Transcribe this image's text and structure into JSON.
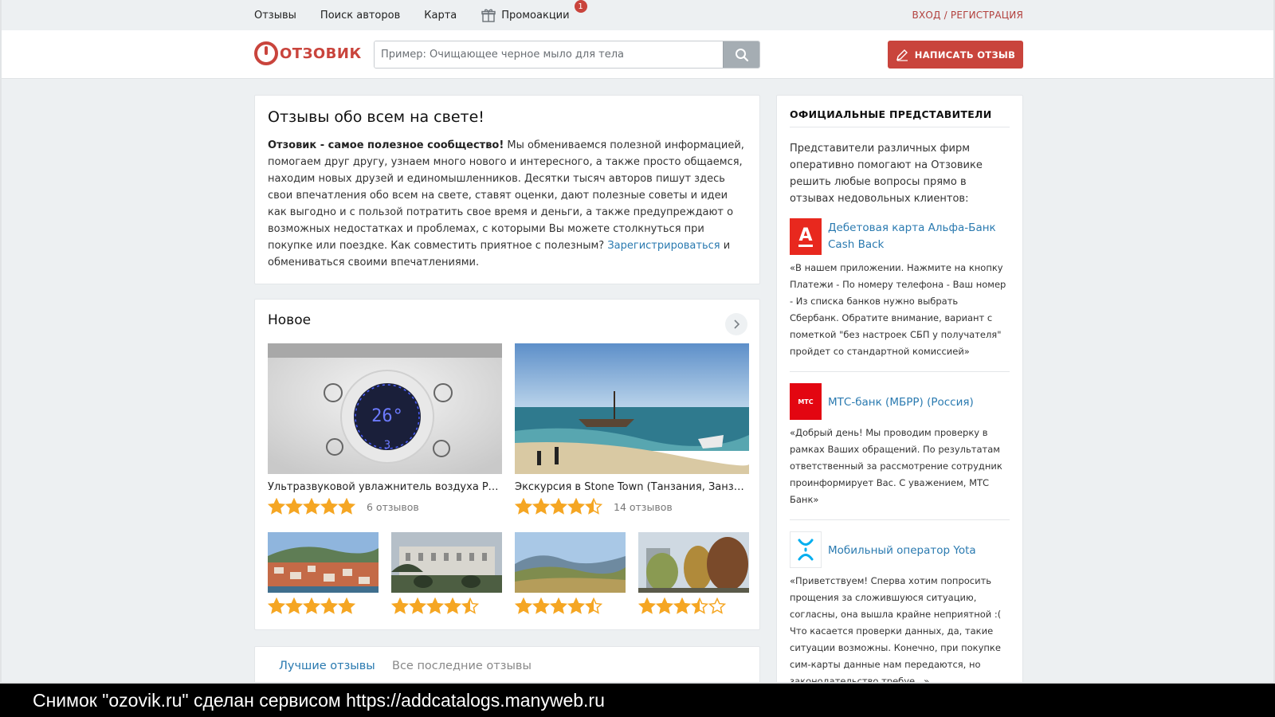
{
  "topnav": {
    "items": [
      "Отзывы",
      "Поиск авторов",
      "Карта",
      "Промоакции"
    ],
    "promo_badge": "1",
    "auth_link": "ВХОД / РЕГИСТРАЦИЯ"
  },
  "header": {
    "logo_text": "ОТЗОВИК",
    "search_placeholder": "Пример: Очищающее черное мыло для тела",
    "write_button": "НАПИСАТЬ ОТЗЫВ"
  },
  "intro": {
    "title": "Отзывы обо всем на свете!",
    "bold_lead": "Отзовик - самое полезное сообщество!",
    "text": " Мы обмениваемся полезной информацией, помогаем друг другу, узнаем много нового и интересного, а также просто общаемся, находим новых друзей и единомышленников. Десятки тысяч авторов пишут здесь свои впечатления обо всем на свете, ставят оценки, дают полезные советы и идеи как выгодно и с пользой потратить свое время и деньги, а также предупреждают о возможных недостатках и проблемах, с которыми Вы можете столкнуться при покупке или поездке. Как совместить приятное с полезным? ",
    "register_link": "Зарегистрироваться",
    "text_end": " и обмениваться своими впечатлениями."
  },
  "new_section": {
    "title": "Новое",
    "big_items": [
      {
        "title": "Ультразвуковой увлажнитель воздуха Prim...",
        "rating": 5,
        "reviews": "6 отзывов"
      },
      {
        "title": "Экскурсия в Stone Town (Танзания, Занзиб...",
        "rating": 4.5,
        "reviews": "14 отзывов"
      }
    ],
    "small_items": [
      {
        "rating": 5
      },
      {
        "rating": 4.5
      },
      {
        "rating": 4.5
      },
      {
        "rating": 3.5
      }
    ]
  },
  "tabs": {
    "best": "Лучшие отзывы",
    "latest": "Все последние отзывы"
  },
  "sidebar": {
    "title": "ОФИЦИАЛЬНЫЕ ПРЕДСТАВИТЕЛИ",
    "intro": "Представители различных фирм оперативно помогают на Отзовике решить любые вопросы прямо в отзывах недовольных клиентов:",
    "reps": [
      {
        "name": "Дебетовая карта Альфа-Банк Cash Back",
        "quote": "«В нашем приложении. Нажмите на кнопку Платежи - По номеру телефона - Ваш номер - Из списка банков нужно выбрать Сбербанк. Обратите внимание, вариант с пометкой \"без настроек СБП у получателя\" пройдет со стандартной комиссией»",
        "logo": "alfa-bank-icon",
        "logo_letter": "А",
        "color": "#e8281e"
      },
      {
        "name": "МТС-банк (МБРР) (Россия)",
        "quote": "«Добрый день! Мы проводим проверку в рамках Ваших обращений. По результатам ответственный за рассмотрение сотрудник проинформирует Вас. С уважением, МТС Банк»",
        "logo": "mts-bank-icon",
        "logo_letter": "МТС",
        "color": "#e30611"
      },
      {
        "name": "Мобильный оператор Yota",
        "quote": "«Приветствуем! Сперва хотим попросить прощения за сложившуюся ситуацию, согласны, она вышла крайне неприятной :( Что касается проверки данных, да, такие ситуации возможны. Конечно, при покупке сим-карты данные нам передаются, но законодательство требуе...»",
        "logo": "yota-icon",
        "color": "#00aeef"
      }
    ]
  },
  "caption": "Снимок \"ozovik.ru\" сделан сервисом https://addcatalogs.manyweb.ru",
  "colors": {
    "accent": "#c9443c",
    "link": "#2a7ab0",
    "star": "#f5a623"
  }
}
